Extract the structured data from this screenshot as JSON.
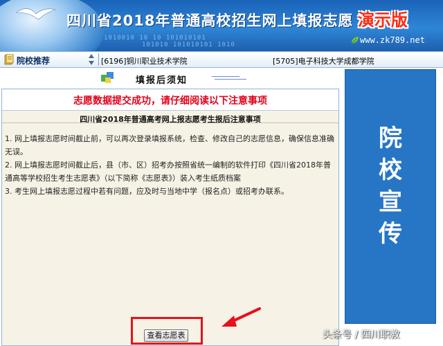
{
  "header": {
    "title": "四川省2018年普通高校招生网上填报志愿",
    "demo_label": "演示版",
    "site_url": "www.zk789.net",
    "binary_deco_1": "1010010 10 10 101010101",
    "binary_deco_2": "101010 101010101 1010"
  },
  "recommend_bar": {
    "label": "院校推荐",
    "schools": [
      "[6196]铜川职业技术学院",
      "[5705]电子科技大学成都学院"
    ]
  },
  "page": {
    "title": "填报后须知",
    "success_message": "志愿数据提交成功，请仔细阅读以下注意事项",
    "notice_title": "四川省2018年普通高考网上报志愿考生报后注意事项",
    "notice_items": [
      "1. 网上填报志愿时间截止前，可以再次登录填报系统，检查、修改自己的志愿信息，确保信息准确无误。",
      "2. 网上填报志愿时间截止后，县（市、区）招考办按照省统一编制的软件打印《四川省2018年普通高等学校招生考生志愿表》（以下简称《志愿表》）装入考生纸质档案",
      "3. 考生网上填报志愿过程中若有问题，应及时与当地中学（报名点）或招考办联系。"
    ],
    "view_button": "查看志愿表"
  },
  "sidebar": {
    "chars": [
      "院",
      "校",
      "宣",
      "传"
    ]
  },
  "watermark": "头条号 / 四川职教",
  "colors": {
    "banner_blue": "#2f86d6",
    "success_red": "#e2001a",
    "highlight_red": "#e8101c",
    "sidebar_blue": "#2776c6",
    "content_bg": "#f6f3e6"
  }
}
